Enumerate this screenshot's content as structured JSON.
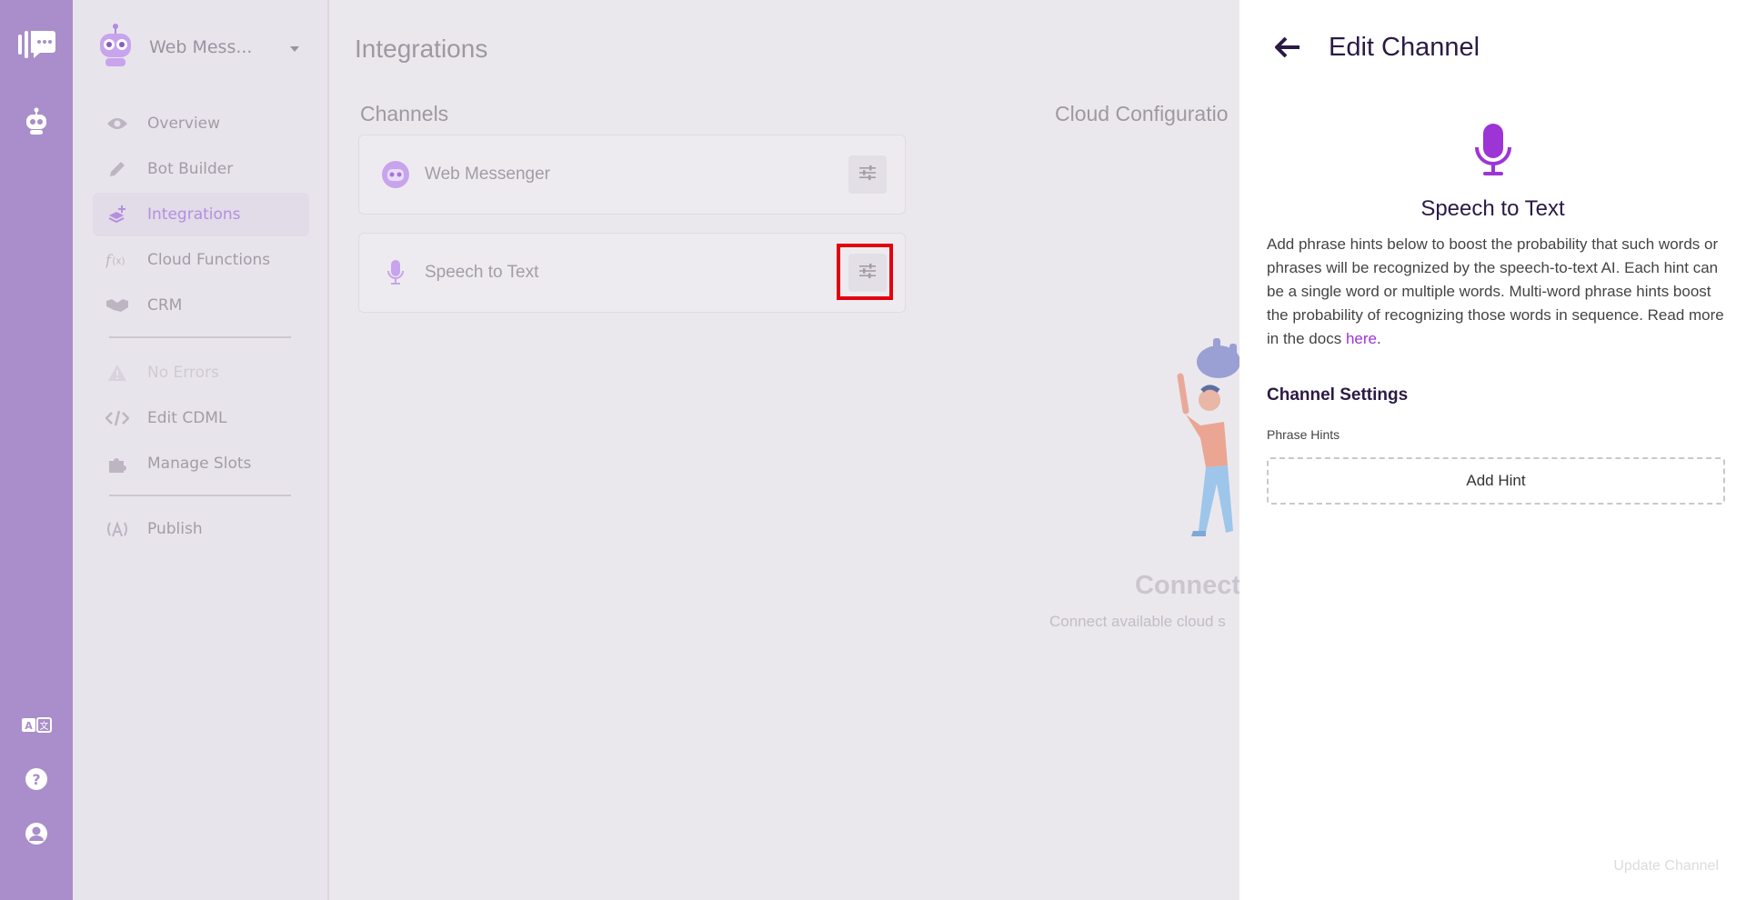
{
  "rail": {
    "icons": [
      "chat-logo-icon",
      "bot-icon",
      "translate-icon",
      "help-icon",
      "account-icon"
    ]
  },
  "sidebar": {
    "bot_name": "Web Mess...",
    "items": [
      {
        "label": "Overview",
        "icon": "eye-icon"
      },
      {
        "label": "Bot Builder",
        "icon": "pencil-icon"
      },
      {
        "label": "Integrations",
        "icon": "layers-plus-icon",
        "active": true
      },
      {
        "label": "Cloud Functions",
        "icon": "function-icon"
      },
      {
        "label": "CRM",
        "icon": "handshake-icon"
      },
      {
        "label": "No Errors",
        "icon": "warning-icon",
        "disabled": true
      },
      {
        "label": "Edit CDML",
        "icon": "code-icon"
      },
      {
        "label": "Manage Slots",
        "icon": "puzzle-icon"
      },
      {
        "label": "Publish",
        "icon": "broadcast-icon"
      }
    ]
  },
  "main": {
    "title": "Integrations",
    "channels_title": "Channels",
    "cloud_title": "Cloud Configuratio",
    "channels": [
      {
        "label": "Web Messenger",
        "icon": "bot-face-icon"
      },
      {
        "label": "Speech to Text",
        "icon": "microphone-icon"
      }
    ],
    "empty_title": "Connect",
    "empty_sub": "Connect available cloud s"
  },
  "drawer": {
    "title": "Edit Channel",
    "service_name": "Speech to Text",
    "description": "Add phrase hints below to boost the probability that such words or phrases will be recognized by the speech-to-text AI. Each hint can be a single word or multiple words. Multi-word phrase hints boost the probability of recognizing those words in sequence. Read more in the docs ",
    "link_text": "here",
    "settings_title": "Channel Settings",
    "phrase_hints_label": "Phrase Hints",
    "add_hint_label": "Add Hint",
    "update_label": "Update Channel"
  },
  "colors": {
    "rail": "#a98ecb",
    "accent": "#9d35d6",
    "highlight": "#e3000f"
  }
}
